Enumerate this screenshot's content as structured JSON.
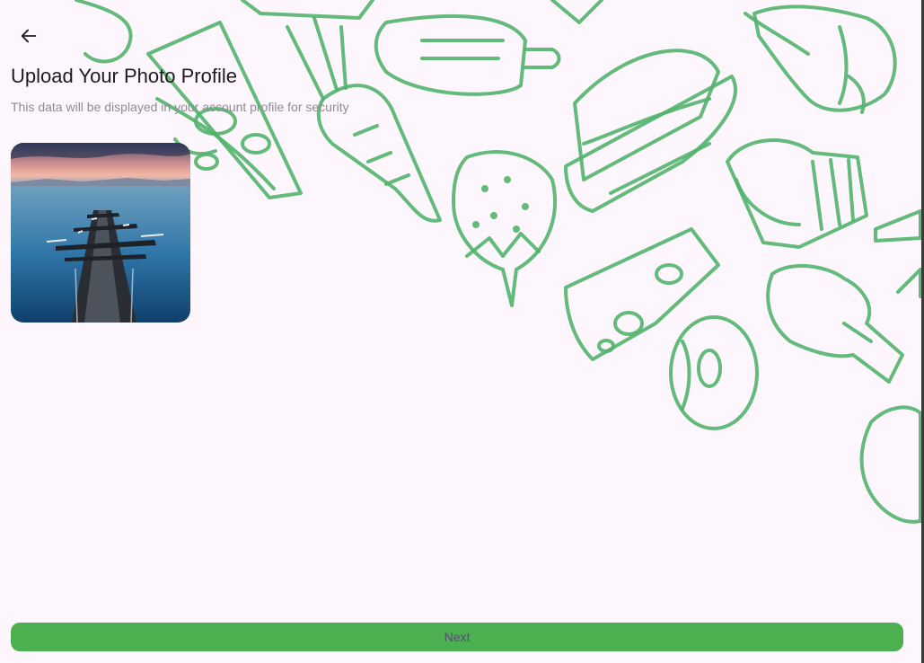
{
  "header": {
    "back_icon": "arrow-left-icon"
  },
  "main": {
    "title": "Upload Your Photo Profile",
    "subtitle": "This data will be displayed in your account profile for security",
    "photo": {
      "alt": "Pier stretching into calm blue water at sunset"
    }
  },
  "footer": {
    "next_label": "Next"
  },
  "colors": {
    "background": "#fdf7fd",
    "accent": "#4caf50",
    "doodle": "#52b26d",
    "title": "#1d1b20",
    "subtitle": "#8f8b93",
    "button_text": "#5a4a7c"
  }
}
